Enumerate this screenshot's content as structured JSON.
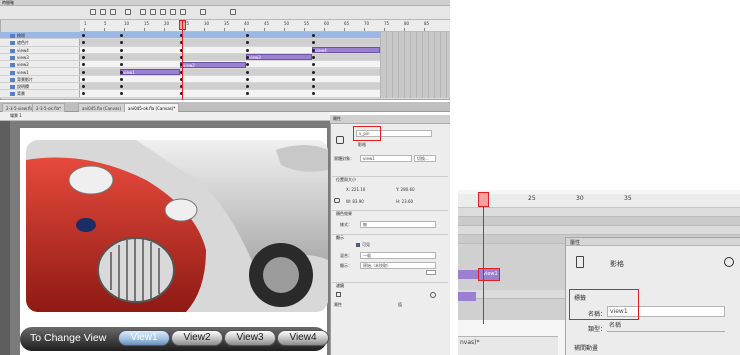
{
  "timeline": {
    "panel_title": "時間軸",
    "ruler_ticks": [
      "1",
      "5",
      "10",
      "15",
      "20",
      "25",
      "30",
      "35",
      "40",
      "45",
      "50",
      "55",
      "60",
      "65",
      "70",
      "75",
      "80",
      "85"
    ],
    "layers": [
      {
        "label": "按鈕",
        "selected": true
      },
      {
        "label": "遮色片",
        "selected": false
      },
      {
        "label": "view4",
        "selected": false
      },
      {
        "label": "view3",
        "selected": false
      },
      {
        "label": "view2",
        "selected": false
      },
      {
        "label": "view1",
        "selected": false
      },
      {
        "label": "背景影片",
        "selected": false
      },
      {
        "label": "說明欄",
        "selected": false
      },
      {
        "label": "背景",
        "selected": false
      }
    ],
    "tween_labels": [
      "view4",
      "view3",
      "view2",
      "view1"
    ]
  },
  "tabs": [
    {
      "label": "2-3-5-view.fla*",
      "active": false
    },
    {
      "label": "2-3-5-ok.fla*",
      "active": false
    },
    {
      "label": "ani045.fla (Canvas)",
      "active": false
    },
    {
      "label": "ani045-ok.fla (Canvas)*",
      "active": true
    }
  ],
  "scene": {
    "label": "場景 1"
  },
  "stage": {
    "bar_label": "To Change View",
    "buttons": [
      "View1",
      "View2",
      "View3",
      "View4"
    ]
  },
  "properties": {
    "tab_label": "屬性",
    "instance_name": "v_pin",
    "type_label": "影格",
    "name_label": "實體對象：",
    "name_value": "view1",
    "swap_label": "切換...",
    "position_section": "位置與大小",
    "x": "X: 221.10",
    "y": "Y: 280.60",
    "w": "W: 83.90",
    "h": "H: 23.60",
    "color_section": "顏色效果",
    "style_label": "樣式：",
    "style_value": "無",
    "display_section": "顯示",
    "visible_label": "可見",
    "blend_label": "混合：",
    "blend_value": "一般",
    "render_label": "顯示：",
    "render_value": "原始（未快取）",
    "filter_section": "濾鏡",
    "attr_label": "屬性",
    "value_label": "值"
  },
  "inset": {
    "ruler_ticks": [
      "20",
      "25",
      "30",
      "35"
    ],
    "tween_label": "view1",
    "panel_tab": "屬性",
    "panel_type": "影格",
    "label_section": "標籤",
    "name_label": "名稱：",
    "name_value": "view1",
    "type_label": "類型：",
    "type_value": "名稱",
    "tween_section": "補間動畫",
    "bottom_tab": "nvas)*"
  },
  "colors": {
    "tween": "#9b7fd1",
    "playhead": "#e02020",
    "highlight": "#e02020",
    "selected_layer": "#9ab7e6"
  }
}
